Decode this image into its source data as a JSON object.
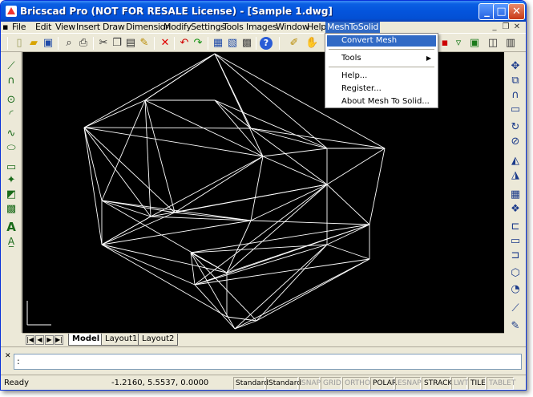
{
  "window": {
    "title": "Bricscad Pro (NOT FOR RESALE License) - [Sample 1.dwg]",
    "minimize_glyph": "_",
    "maximize_glyph": "□",
    "close_glyph": "✕"
  },
  "menubar": {
    "items": [
      "File",
      "Edit",
      "View",
      "Insert",
      "Draw",
      "Dimension",
      "Modify",
      "Settings",
      "Tools",
      "Images",
      "Window",
      "Help",
      "MeshToSolid"
    ],
    "mdi_controls": [
      "_",
      "❐",
      "✕"
    ]
  },
  "dropdown": {
    "items": [
      "Convert Mesh",
      "Tools",
      "Help...",
      "Register...",
      "About Mesh To Solid..."
    ],
    "submenu_arrow": "▶"
  },
  "layout_tabs": {
    "nav": [
      "|◀",
      "◀",
      "▶",
      "▶|"
    ],
    "tabs": [
      "Model",
      "Layout1",
      "Layout2"
    ]
  },
  "command": {
    "close_glyph": "✕",
    "prompt": ":"
  },
  "statusbar": {
    "ready": "Ready",
    "coords": "-1.2160, 5.5537, 0.0000",
    "panes": [
      {
        "label": "Standard",
        "on": true
      },
      {
        "label": "Standard",
        "on": true
      },
      {
        "label": "SNAP",
        "on": false
      },
      {
        "label": "GRID",
        "on": false
      },
      {
        "label": "ORTHO",
        "on": false
      },
      {
        "label": "POLAR",
        "on": true
      },
      {
        "label": "ESNAP",
        "on": false
      },
      {
        "label": "STRACK",
        "on": true
      },
      {
        "label": "LWT",
        "on": false
      },
      {
        "label": "TILE",
        "on": true
      },
      {
        "label": "TABLET",
        "on": false
      }
    ]
  },
  "toolbar_icons": [
    "new-icon",
    "open-icon",
    "save-icon",
    "print-preview-icon",
    "print-icon",
    "cut-icon",
    "copy-icon",
    "paste-icon",
    "match-properties-icon",
    "delete-icon",
    "undo-icon",
    "redo-icon",
    "properties-icon",
    "design-center-icon",
    "layer-icon",
    "help-icon",
    "pencil-icon",
    "pan-icon"
  ],
  "colors": {
    "title_bar": "#0454dc",
    "menu_highlight": "#316ac5",
    "canvas_bg": "#000000",
    "wireframe": "#ffffff"
  }
}
